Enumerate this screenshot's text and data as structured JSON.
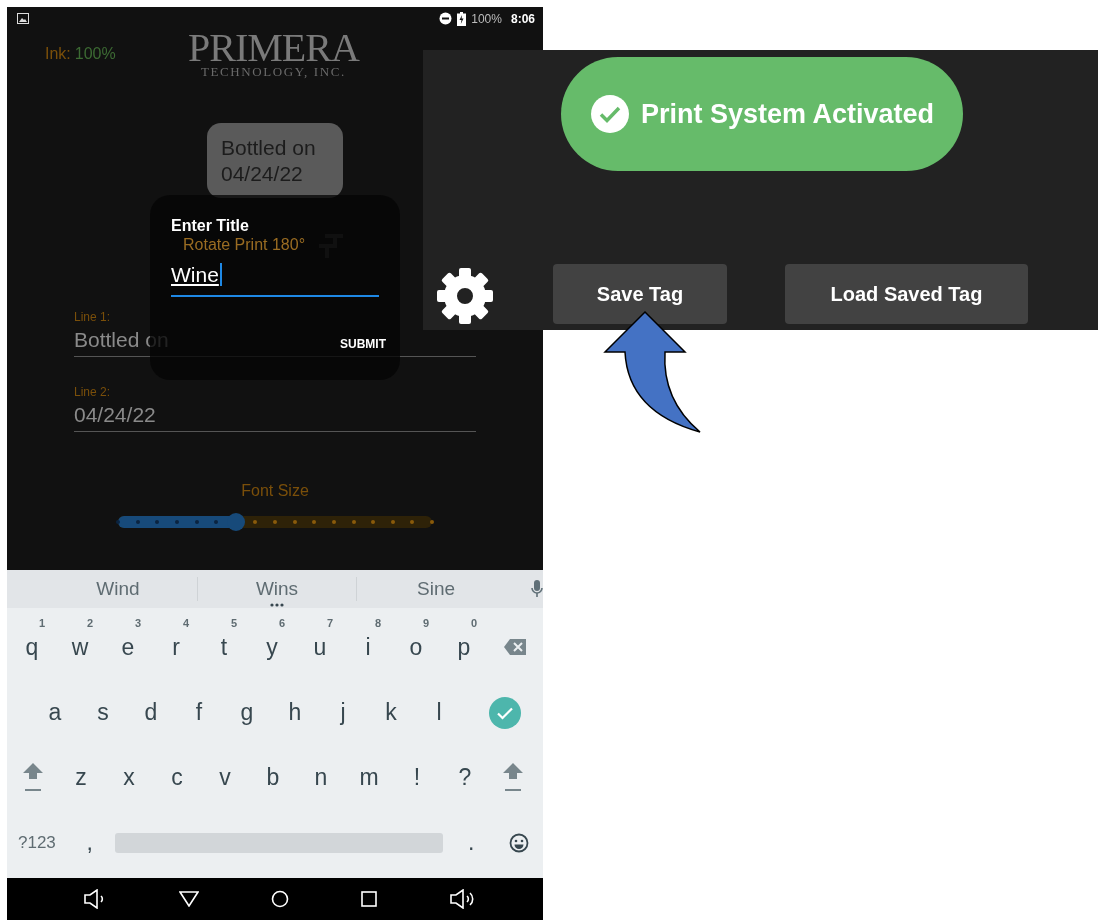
{
  "status_bar": {
    "battery": "100%",
    "time": "8:06"
  },
  "header": {
    "ink_label": "Ink:",
    "ink_value": "100%",
    "logo_name": "PRIMERA",
    "logo_sub": "TECHNOLOGY, INC."
  },
  "preview": {
    "lines": [
      "Bottled on",
      "04/24/22"
    ]
  },
  "rotate": {
    "label": "Rotate Print 180°"
  },
  "fields": [
    {
      "label": "Line 1:",
      "value": "Bottled on"
    },
    {
      "label": "Line 2:",
      "value": "04/24/22"
    }
  ],
  "font_size": {
    "label": "Font Size",
    "level": 0.375
  },
  "dialog": {
    "title": "Enter Title",
    "value": "Wine",
    "submit": "SUBMIT"
  },
  "keyboard": {
    "suggestions": [
      "Wind",
      "Wins",
      "Sine"
    ],
    "rows": [
      [
        {
          "kind": "char",
          "label": "q",
          "hint": "1"
        },
        {
          "kind": "char",
          "label": "w",
          "hint": "2"
        },
        {
          "kind": "char",
          "label": "e",
          "hint": "3"
        },
        {
          "kind": "char",
          "label": "r",
          "hint": "4"
        },
        {
          "kind": "char",
          "label": "t",
          "hint": "5"
        },
        {
          "kind": "char",
          "label": "y",
          "hint": "6"
        },
        {
          "kind": "char",
          "label": "u",
          "hint": "7"
        },
        {
          "kind": "char",
          "label": "i",
          "hint": "8"
        },
        {
          "kind": "char",
          "label": "o",
          "hint": "9"
        },
        {
          "kind": "char",
          "label": "p",
          "hint": "0"
        },
        {
          "kind": "backspace"
        }
      ],
      [
        {
          "kind": "char",
          "label": "a"
        },
        {
          "kind": "char",
          "label": "s"
        },
        {
          "kind": "char",
          "label": "d"
        },
        {
          "kind": "char",
          "label": "f"
        },
        {
          "kind": "char",
          "label": "g"
        },
        {
          "kind": "char",
          "label": "h"
        },
        {
          "kind": "char",
          "label": "j"
        },
        {
          "kind": "char",
          "label": "k"
        },
        {
          "kind": "char",
          "label": "l"
        },
        {
          "kind": "enter"
        }
      ],
      [
        {
          "kind": "shift"
        },
        {
          "kind": "char",
          "label": "z"
        },
        {
          "kind": "char",
          "label": "x"
        },
        {
          "kind": "char",
          "label": "c"
        },
        {
          "kind": "char",
          "label": "v"
        },
        {
          "kind": "char",
          "label": "b"
        },
        {
          "kind": "char",
          "label": "n"
        },
        {
          "kind": "char",
          "label": "m"
        },
        {
          "kind": "char",
          "label": "!"
        },
        {
          "kind": "char",
          "label": "?"
        },
        {
          "kind": "shift"
        }
      ],
      [
        {
          "kind": "symbols",
          "label": "?123"
        },
        {
          "kind": "char",
          "label": ","
        },
        {
          "kind": "space"
        },
        {
          "kind": "char",
          "label": "."
        },
        {
          "kind": "emoji"
        }
      ]
    ]
  },
  "inset": {
    "toast": "Print System Activated",
    "buttons": [
      "Save Tag",
      "Load Saved Tag"
    ]
  }
}
